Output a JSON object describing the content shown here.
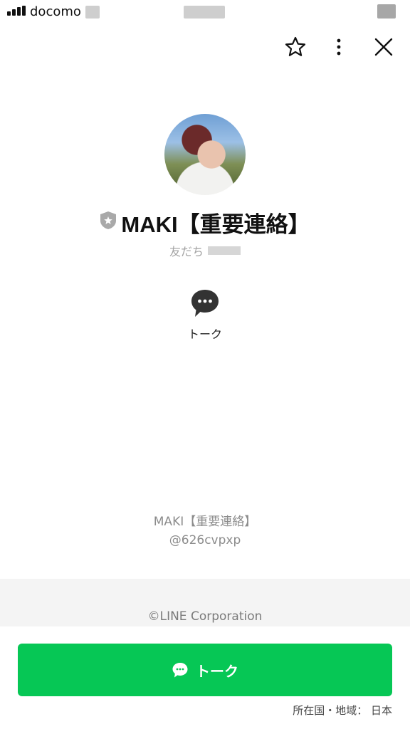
{
  "status_bar": {
    "carrier": "docomo"
  },
  "header": {
    "icons": [
      "star-icon",
      "more-vertical-icon",
      "close-icon"
    ]
  },
  "profile": {
    "name": "MAKI【重要連絡】",
    "friends_label": "友だち",
    "badge_icon": "shield-badge-icon"
  },
  "actions": {
    "talk_label": "トーク"
  },
  "account": {
    "name": "MAKI【重要連絡】",
    "id": "@626cvpxp"
  },
  "footer": {
    "copyright": "©LINE Corporation",
    "talk_button_label": "トーク",
    "region": "所在国・地域： 日本"
  },
  "colors": {
    "accent": "#06c755",
    "badge": "#a9a9a9",
    "footer_band": "#f4f4f4"
  }
}
